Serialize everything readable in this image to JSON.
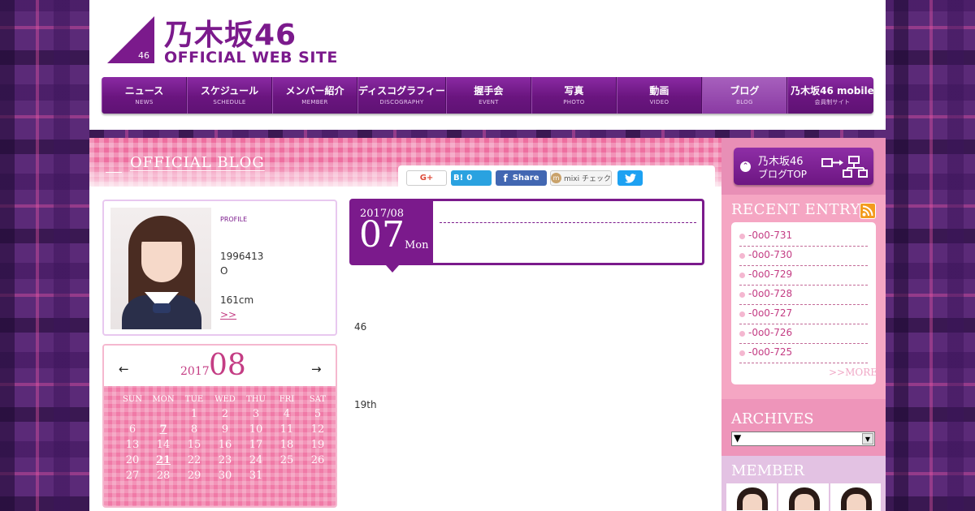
{
  "header": {
    "logo_number": "46",
    "logo_jp": "乃木坂46",
    "logo_en": "OFFICIAL WEB SITE"
  },
  "nav": [
    {
      "label": "ニュース",
      "sub": "NEWS"
    },
    {
      "label": "スケジュール",
      "sub": "SCHEDULE"
    },
    {
      "label": "メンバー紹介",
      "sub": "MEMBER"
    },
    {
      "label": "ディスコグラフィー",
      "sub": "DISCOGRAPHY"
    },
    {
      "label": "握手会",
      "sub": "EVENT"
    },
    {
      "label": "写真",
      "sub": "PHOTO"
    },
    {
      "label": "動画",
      "sub": "VIDEO"
    },
    {
      "label": "ブログ",
      "sub": "BLOG"
    },
    {
      "label": "乃木坂46 mobile",
      "sub": "会員制サイト"
    }
  ],
  "blog": {
    "title": "OFFICIAL BLOG"
  },
  "share": {
    "gplus": "G+",
    "hatena_label": "B!",
    "hatena_count": "0",
    "facebook": "Share",
    "mixi": "mixi チェック",
    "twitter": "🐦"
  },
  "profile": {
    "label": "PROFILE",
    "birth": "1996413",
    "blood": "O",
    "height": "161cm",
    "more": ">>"
  },
  "calendar": {
    "prev": "←",
    "next": "→",
    "year": "2017",
    "month": "08",
    "weekdays": [
      "SUN",
      "MON",
      "TUE",
      "WED",
      "THU",
      "FRI",
      "SAT"
    ],
    "weeks": [
      [
        "",
        "",
        "1",
        "2",
        "3",
        "4",
        "5"
      ],
      [
        "6",
        "7",
        "8",
        "9",
        "10",
        "11",
        "12"
      ],
      [
        "13",
        "14",
        "15",
        "16",
        "17",
        "18",
        "19"
      ],
      [
        "20",
        "21",
        "22",
        "23",
        "24",
        "25",
        "26"
      ],
      [
        "27",
        "28",
        "29",
        "30",
        "31",
        "",
        ""
      ]
    ],
    "linked_days": [
      "7",
      "21"
    ]
  },
  "post": {
    "year_month": "2017/08",
    "day": "07",
    "weekday": "Mon",
    "text_1": "46",
    "text_2": "19th"
  },
  "sidebar": {
    "blog_top_line1": "乃木坂46",
    "blog_top_line2": "ブログTOP",
    "recent_title": "RECENT ENTRY",
    "recent_entries": [
      "-0o0-731",
      "-0o0-730",
      "-0o0-729",
      "-0o0-728",
      "-0o0-727",
      "-0o0-726",
      "-0o0-725"
    ],
    "recent_more": ">>MORE",
    "archives_title": "ARCHIVES",
    "archives_value": "▼",
    "member_title": "MEMBER"
  }
}
